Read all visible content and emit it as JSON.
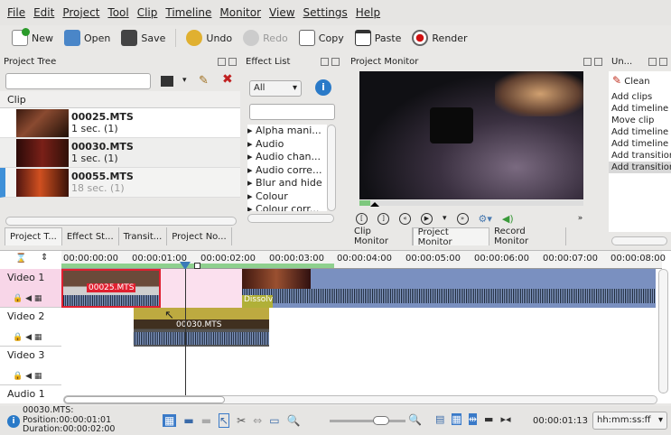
{
  "menu": [
    "File",
    "Edit",
    "Project",
    "Tool",
    "Clip",
    "Timeline",
    "Monitor",
    "View",
    "Settings",
    "Help"
  ],
  "toolbar": {
    "new": "New",
    "open": "Open",
    "save": "Save",
    "undo": "Undo",
    "redo": "Redo",
    "copy": "Copy",
    "paste": "Paste",
    "render": "Render"
  },
  "project_tree": {
    "title": "Project Tree",
    "header": "Clip",
    "clips": [
      {
        "name": "00025.MTS",
        "dur": "1 sec. (1)"
      },
      {
        "name": "00030.MTS",
        "dur": "1 sec. (1)"
      },
      {
        "name": "00055.MTS",
        "dur": "18 sec. (1)"
      }
    ]
  },
  "effect_list": {
    "title": "Effect List",
    "filter": "All",
    "items": [
      "Alpha mani...",
      "Audio",
      "Audio chan...",
      "Audio corre...",
      "Blur and hide",
      "Colour",
      "Colour corr..."
    ]
  },
  "project_monitor": {
    "title": "Project Monitor"
  },
  "undo": {
    "title": "Un...",
    "clean": "Clean",
    "items": [
      "Add clips",
      "Add timeline c",
      "Move clip",
      "Add timeline c",
      "Add timeline c",
      "Add transition",
      "Add transition"
    ]
  },
  "left_tabs": [
    "Project T...",
    "Effect St...",
    "Transit...",
    "Project No..."
  ],
  "monitor_tabs": [
    "Clip Monitor",
    "Project Monitor",
    "Record Monitor"
  ],
  "ruler": [
    "00:00:00:00",
    "00:00:01:00",
    "00:00:02:00",
    "00:00:03:00",
    "00:00:04:00",
    "00:00:05:00",
    "00:00:06:00",
    "00:00:07:00",
    "00:00:08:00"
  ],
  "tracks": [
    "Video 1",
    "Video 2",
    "Video 3",
    "Audio 1"
  ],
  "timeline_clips": {
    "v1": "00025.MTS",
    "v2": "00030.MTS",
    "transition": "Dissolv"
  },
  "status": {
    "file": "00030.MTS:",
    "position": "Position:00:00:01:01",
    "duration": "Duration:00:00:02:00",
    "timecode": "00:00:01:13",
    "format": "hh:mm:ss:ff"
  }
}
